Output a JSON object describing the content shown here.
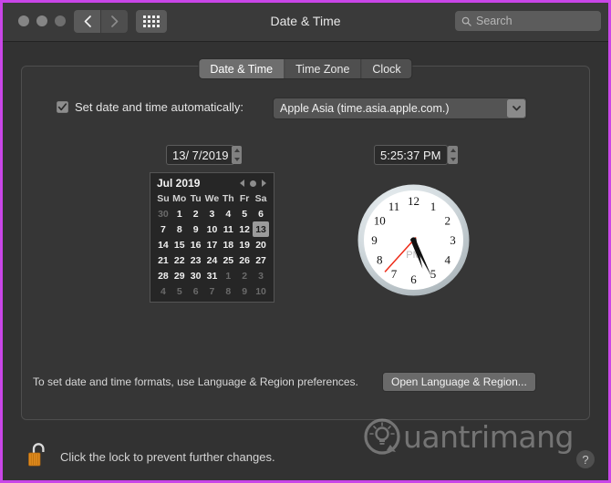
{
  "window": {
    "title": "Date & Time",
    "traffic_lights": [
      "close",
      "minimize",
      "zoom"
    ],
    "nav": {
      "back": "‹",
      "forward": "›"
    },
    "grid_button": "show-all-icon"
  },
  "search": {
    "placeholder": "Search",
    "icon": "search-icon"
  },
  "tabs": [
    {
      "label": "Date & Time",
      "active": true
    },
    {
      "label": "Time Zone",
      "active": false
    },
    {
      "label": "Clock",
      "active": false
    }
  ],
  "auto": {
    "checkbox_checked": true,
    "label": "Set date and time automatically:",
    "server": "Apple Asia (time.asia.apple.com.)"
  },
  "fields": {
    "date_value": "13/  7/2019",
    "time_value": "5:25:37 PM"
  },
  "calendar": {
    "month_label": "Jul 2019",
    "prev": "prev-month-arrow",
    "today": "today-dot",
    "next": "next-month-arrow",
    "weekdays": [
      "Su",
      "Mo",
      "Tu",
      "We",
      "Th",
      "Fr",
      "Sa"
    ],
    "weeks": [
      [
        {
          "d": "30",
          "muted": true
        },
        {
          "d": "1"
        },
        {
          "d": "2"
        },
        {
          "d": "3"
        },
        {
          "d": "4"
        },
        {
          "d": "5"
        },
        {
          "d": "6"
        }
      ],
      [
        {
          "d": "7"
        },
        {
          "d": "8"
        },
        {
          "d": "9"
        },
        {
          "d": "10"
        },
        {
          "d": "11"
        },
        {
          "d": "12"
        },
        {
          "d": "13",
          "selected": true
        }
      ],
      [
        {
          "d": "14"
        },
        {
          "d": "15"
        },
        {
          "d": "16"
        },
        {
          "d": "17"
        },
        {
          "d": "18"
        },
        {
          "d": "19"
        },
        {
          "d": "20"
        }
      ],
      [
        {
          "d": "21"
        },
        {
          "d": "22"
        },
        {
          "d": "23"
        },
        {
          "d": "24"
        },
        {
          "d": "25"
        },
        {
          "d": "26"
        },
        {
          "d": "27"
        }
      ],
      [
        {
          "d": "28"
        },
        {
          "d": "29"
        },
        {
          "d": "30"
        },
        {
          "d": "31"
        },
        {
          "d": "1",
          "muted": true
        },
        {
          "d": "2",
          "muted": true
        },
        {
          "d": "3",
          "muted": true
        }
      ],
      [
        {
          "d": "4",
          "muted": true
        },
        {
          "d": "5",
          "muted": true
        },
        {
          "d": "6",
          "muted": true
        },
        {
          "d": "7",
          "muted": true
        },
        {
          "d": "8",
          "muted": true
        },
        {
          "d": "9",
          "muted": true
        },
        {
          "d": "10",
          "muted": true
        }
      ]
    ]
  },
  "clock": {
    "numerals": [
      "1",
      "2",
      "3",
      "4",
      "5",
      "6",
      "7",
      "8",
      "9",
      "10",
      "11",
      "12"
    ],
    "meridiem": "PM",
    "hour": 5,
    "minute": 25,
    "second": 37,
    "hand_color": "#101010",
    "second_hand_color": "#ee2b18",
    "face_color": "#ffffff",
    "bezel_color": "#c9d2d6"
  },
  "footer": {
    "note": "To set date and time formats, use Language & Region preferences.",
    "open_button": "Open Language & Region..."
  },
  "lock": {
    "icon": "unlocked-padlock-icon",
    "message": "Click the lock to prevent further changes."
  },
  "watermark": {
    "text": "uantrimang",
    "logo": "lightbulb-logo-icon"
  },
  "help": {
    "label": "?"
  }
}
